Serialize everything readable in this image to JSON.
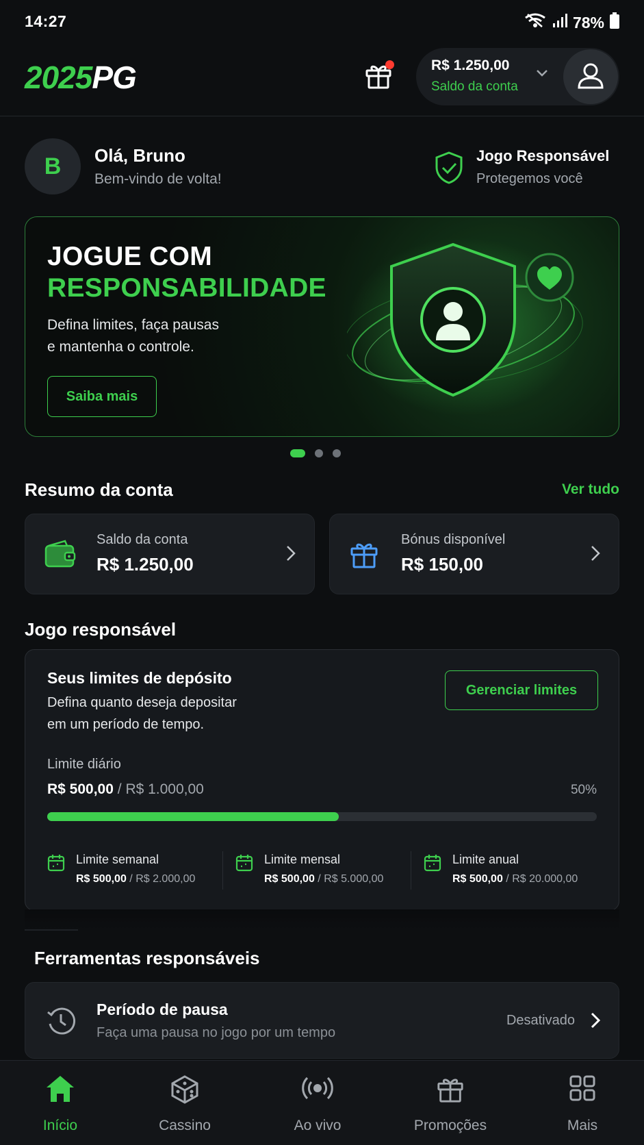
{
  "status_bar": {
    "time": "14:27",
    "battery": "78%"
  },
  "header": {
    "logo_part1": "2025",
    "logo_part2": "PG",
    "balance_amount": "R$ 1.250,00",
    "balance_label": "Saldo da conta"
  },
  "greeting": {
    "avatar_initial": "B",
    "name": "Olá, Bruno",
    "subtitle": "Bem-vindo de volta!",
    "rg_title": "Jogo Responsável",
    "rg_subtitle": "Protegemos você"
  },
  "banner": {
    "title_line1": "JOGUE COM",
    "title_line2": "RESPONSABILIDADE",
    "desc_line1": "Defina limites, faça pausas",
    "desc_line2": "e mantenha o controle.",
    "button": "Saiba mais",
    "slide_count": 3,
    "active_slide": 0
  },
  "summary": {
    "title": "Resumo da conta",
    "see_all": "Ver tudo",
    "cards": [
      {
        "label": "Saldo da conta",
        "value": "R$ 1.250,00",
        "icon": "wallet-icon"
      },
      {
        "label": "Bónus disponível",
        "value": "R$ 150,00",
        "icon": "gift-icon"
      }
    ]
  },
  "responsible": {
    "title": "Jogo responsável",
    "limits_title": "Seus limites de depósito",
    "limits_desc_line1": "Defina quanto deseja depositar",
    "limits_desc_line2": "em um período de tempo.",
    "manage_button": "Gerenciar limites",
    "daily_label": "Limite diário",
    "daily_current": "R$ 500,00",
    "daily_separator": " / ",
    "daily_max": "R$ 1.000,00",
    "daily_percent": "50%",
    "daily_progress": 0.53,
    "sub_limits": [
      {
        "title": "Limite semanal",
        "current": "R$ 500,00",
        "max": "R$ 2.000,00"
      },
      {
        "title": "Limite mensal",
        "current": "R$ 500,00",
        "max": "R$ 5.000,00"
      },
      {
        "title": "Limite anual",
        "current": "R$ 500,00",
        "max": "R$ 20.000,00"
      }
    ]
  },
  "tools": {
    "title": "Ferramentas responsáveis",
    "items": [
      {
        "title": "Período de pausa",
        "subtitle": "Faça uma pausa no jogo por um tempo",
        "status": "Desativado",
        "icon": "clock-icon"
      }
    ]
  },
  "bottom_nav": {
    "items": [
      {
        "label": "Início",
        "icon": "home-icon",
        "active": true
      },
      {
        "label": "Cassino",
        "icon": "dice-icon",
        "active": false
      },
      {
        "label": "Ao vivo",
        "icon": "live-icon",
        "active": false
      },
      {
        "label": "Promoções",
        "icon": "gift-icon",
        "active": false
      },
      {
        "label": "Mais",
        "icon": "grid-icon",
        "active": false
      }
    ]
  },
  "colors": {
    "accent": "#3ecf4e",
    "background": "#0d0f11",
    "card": "#1a1d21",
    "notification": "#ff3b30",
    "bonus_icon": "#4d9df8"
  }
}
